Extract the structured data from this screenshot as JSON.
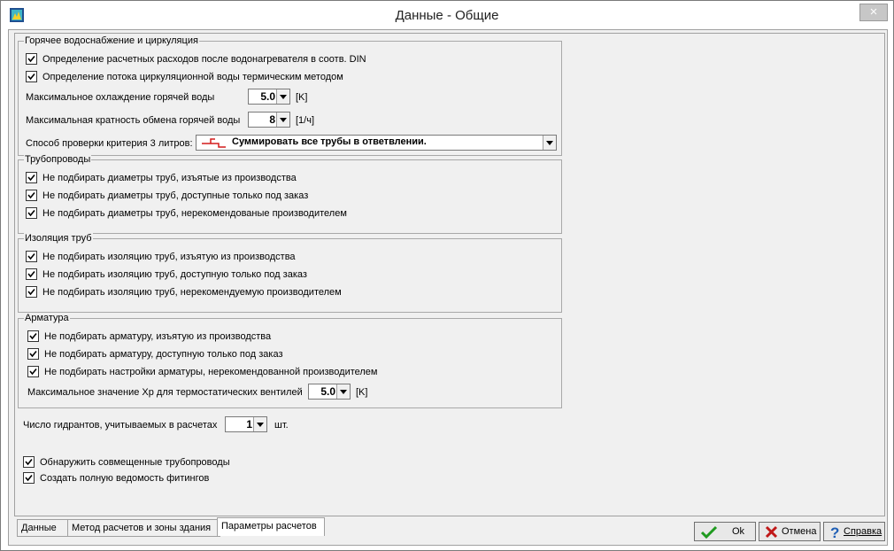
{
  "window": {
    "title": "Данные - Общие",
    "close_label": "×"
  },
  "hot_water": {
    "title": "Горячее водоснабжение и циркуляция",
    "opt_din": "Определение расчетных расходов после водонагревателя в соотв. DIN",
    "opt_thermal": "Определение потока циркуляционной воды термическим методом",
    "max_cooling_label": "Максимальное охлаждение горячей воды",
    "max_cooling_value": "5.0",
    "max_cooling_unit": "[K]",
    "max_exchange_label": "Максимальная кратность обмена горячей воды",
    "max_exchange_value": "8",
    "max_exchange_unit": "[1/ч]",
    "criterion_label": "Способ проверки критерия 3 литров:",
    "criterion_value": "Суммировать все трубы в ответвлении."
  },
  "pipes": {
    "title": "Трубопроводы",
    "opt1": "Не подбирать диаметры труб, изъятые из производства",
    "opt2": "Не подбирать диаметры труб, доступные только под заказ",
    "opt3": "Не подбирать диаметры труб, нерекомендованые производителем"
  },
  "insulation": {
    "title": "Изоляция труб",
    "opt1": "Не подбирать изоляцию труб, изъятую из производства",
    "opt2": "Не подбирать изоляцию труб, доступную только под заказ",
    "opt3": "Не подбирать изоляцию труб, нерекомендуемую производителем"
  },
  "fittings": {
    "title": "Арматура",
    "opt1": "Не подбирать арматуру, изъятую из производства",
    "opt2": "Не подбирать арматуру, доступную только под заказ",
    "opt3": "Не подбирать настройки арматуры, нерекомендованной производителем",
    "xp_label": "Максимальное значение Xp для термостатических вентилей",
    "xp_value": "5.0",
    "xp_unit": "[K]"
  },
  "hydrants": {
    "label": "Число гидрантов, учитываемых в расчетах",
    "value": "1",
    "unit": "шт."
  },
  "extra": {
    "opt_combined": "Обнаружить совмещенные трубопроводы",
    "opt_fittings_list": "Создать полную ведомость фитингов"
  },
  "tabs": [
    {
      "label": "Данные"
    },
    {
      "label": "Метод расчетов и зоны здания"
    },
    {
      "label": "Параметры расчетов"
    }
  ],
  "buttons": {
    "ok": "Ok",
    "cancel": "Отмена",
    "help": "Справка"
  },
  "colors": {
    "ok_check": "#1f9a1f",
    "cancel_x": "#c01818",
    "help_q": "#1f5fb5"
  }
}
